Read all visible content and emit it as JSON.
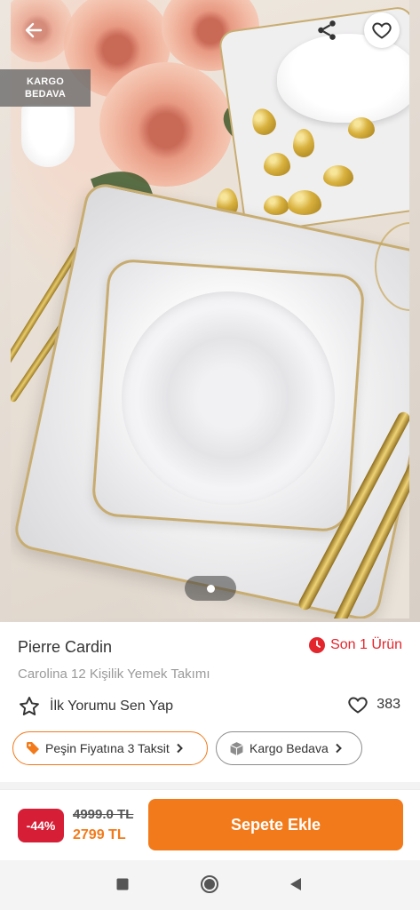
{
  "hero": {
    "cargo_badge": {
      "line1": "KARGO",
      "line2": "BEDAVA"
    },
    "pager": {
      "current": 1
    }
  },
  "icons": {
    "back": "arrow-left-icon",
    "share": "share-icon",
    "favorite": "heart-icon",
    "stock": "clock-icon",
    "star": "star-icon",
    "likes": "heart-icon",
    "installment": "tag-icon",
    "cargo": "box-icon",
    "chevron": "chevron-right-icon",
    "nav_recent": "square-icon",
    "nav_home": "circle-icon",
    "nav_back": "triangle-left-icon"
  },
  "product": {
    "brand": "Pierre Cardin",
    "name": "Carolina 12 Kişilik Yemek Takımı",
    "stock_label": "Son 1 Ürün",
    "review_prompt": "İlk Yorumu Sen Yap",
    "like_count": "383"
  },
  "tags": {
    "installment": "Peşin Fiyatına 3 Taksit",
    "cargo": "Kargo Bedava"
  },
  "purchase": {
    "discount": "-44%",
    "old_price": "4999.0 TL",
    "new_price": "2799 TL",
    "add_to_cart": "Sepete Ekle"
  },
  "colors": {
    "accent": "#f27a1a",
    "discount": "#d61f36",
    "stock": "#e3262d"
  }
}
